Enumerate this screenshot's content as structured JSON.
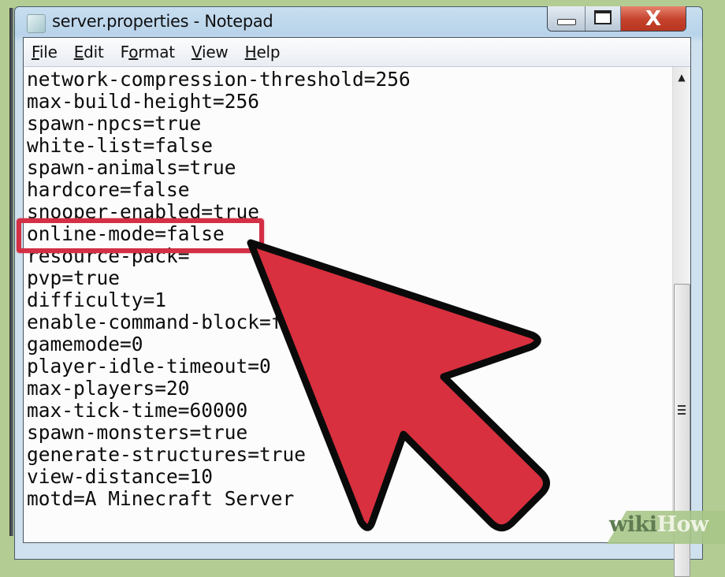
{
  "window": {
    "title": "server.properties - Notepad",
    "icon": "notepad-icon",
    "caption_buttons": {
      "minimize": "minimize-icon",
      "maximize": "maximize-icon",
      "close_label": "X"
    }
  },
  "menubar": {
    "items": [
      {
        "label": "File",
        "mnemonic": "F"
      },
      {
        "label": "Edit",
        "mnemonic": "E"
      },
      {
        "label": "Format",
        "mnemonic": "o"
      },
      {
        "label": "View",
        "mnemonic": "V"
      },
      {
        "label": "Help",
        "mnemonic": "H"
      }
    ]
  },
  "editor": {
    "lines": [
      "network-compression-threshold=256",
      "max-build-height=256",
      "spawn-npcs=true",
      "white-list=false",
      "spawn-animals=true",
      "hardcore=false",
      "snooper-enabled=true",
      "online-mode=false",
      "resource-pack=",
      "pvp=true",
      "difficulty=1",
      "enable-command-block=false",
      "gamemode=0",
      "player-idle-timeout=0",
      "max-players=20",
      "max-tick-time=60000",
      "spawn-monsters=true",
      "generate-structures=true",
      "view-distance=10",
      "motd=A Minecraft Server"
    ],
    "highlighted_line": "online-mode=false"
  },
  "annotation": {
    "highlight_color": "#d32f45",
    "arrow_color": "#d8303f",
    "arrow_outline": "#0a0a0a"
  },
  "watermark": {
    "part1": "wiki",
    "part2": "How"
  }
}
